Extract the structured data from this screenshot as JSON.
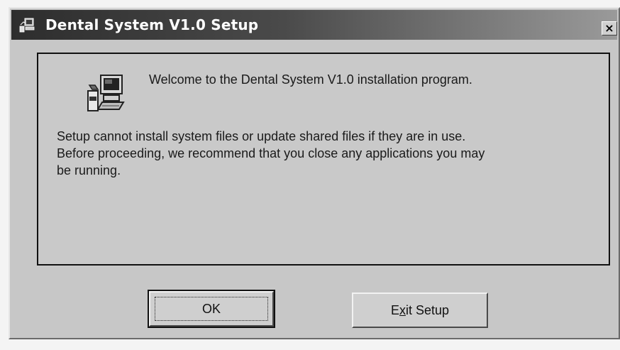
{
  "window": {
    "title": "Dental System V1.0 Setup",
    "close_glyph": "×"
  },
  "panel": {
    "welcome": "Welcome to the Dental System V1.0 installation program.",
    "message_line1": "Setup cannot install system files or update shared files if they are in use.",
    "message_line2": "Before proceeding, we recommend that you close any applications you may",
    "message_line3": "be running."
  },
  "buttons": {
    "ok": "OK",
    "exit_pre": "E",
    "exit_mnemonic": "x",
    "exit_post": "it Setup"
  },
  "icons": {
    "title": "setup-computer-icon",
    "panel": "setup-computer-icon"
  },
  "colors": {
    "titlebar_start": "#2d2d2d",
    "titlebar_end": "#9a9a9a",
    "dialog_face": "#c7c7c7"
  }
}
